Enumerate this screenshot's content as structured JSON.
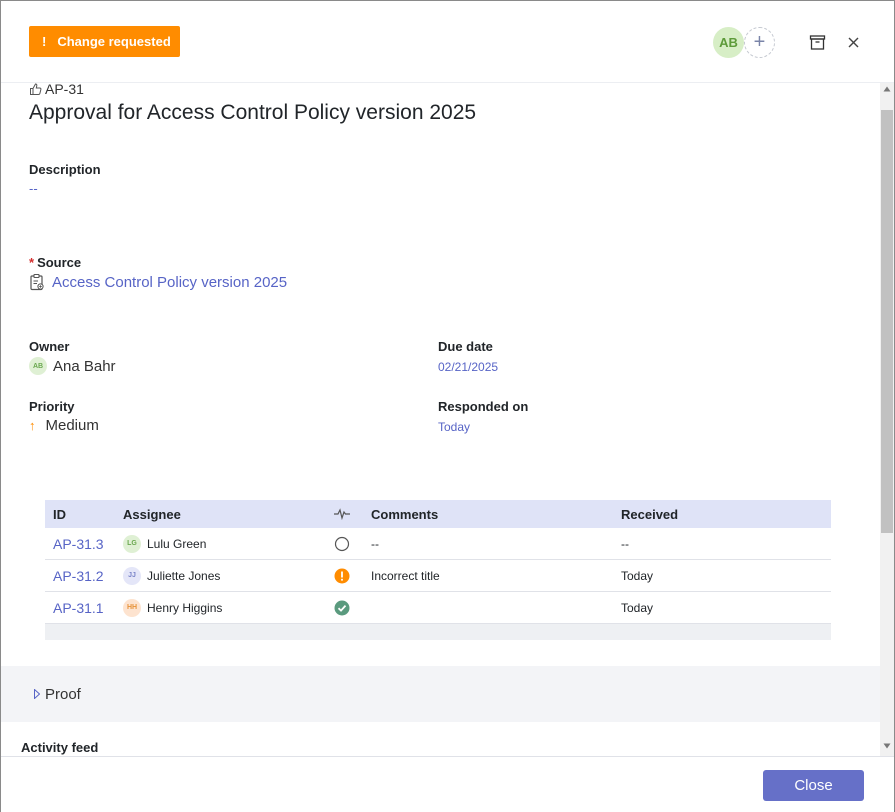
{
  "header": {
    "status_badge": "Change requested",
    "status_icon": "!",
    "avatar_initials": "AB",
    "add_member_icon": "+"
  },
  "item": {
    "id": "AP-31",
    "title": "Approval for Access Control Policy version 2025"
  },
  "fields": {
    "description_label": "Description",
    "description_value": "--",
    "source_label": "Source",
    "source_required": "*",
    "source_value": "Access Control Policy version 2025",
    "owner_label": "Owner",
    "owner_initials": "AB",
    "owner_value": "Ana Bahr",
    "due_label": "Due date",
    "due_value": "02/21/2025",
    "priority_label": "Priority",
    "priority_value": "Medium",
    "responded_label": "Responded on",
    "responded_value": "Today"
  },
  "table": {
    "headers": {
      "id": "ID",
      "assignee": "Assignee",
      "comments": "Comments",
      "received": "Received"
    },
    "rows": [
      {
        "id": "AP-31.3",
        "initials": "LG",
        "assignee": "Lulu Green",
        "status": "pending",
        "comments": "--",
        "received": "--",
        "avatar_bg": "#dff0d4",
        "avatar_fg": "#6aa84f"
      },
      {
        "id": "AP-31.2",
        "initials": "JJ",
        "assignee": "Juliette Jones",
        "status": "change-requested",
        "comments": "Incorrect title",
        "received": "Today",
        "avatar_bg": "#e4e6f8",
        "avatar_fg": "#7a84c8"
      },
      {
        "id": "AP-31.1",
        "initials": "HH",
        "assignee": "Henry Higgins",
        "status": "approved",
        "comments": "",
        "received": "Today",
        "avatar_bg": "#fde3cf",
        "avatar_fg": "#e69138"
      }
    ]
  },
  "sections": {
    "proof": "Proof",
    "activity_feed": "Activity feed"
  },
  "footer": {
    "close_label": "Close"
  },
  "colors": {
    "accent": "#5764c6",
    "warning": "#ff8c00",
    "success": "#5a9a7e"
  }
}
